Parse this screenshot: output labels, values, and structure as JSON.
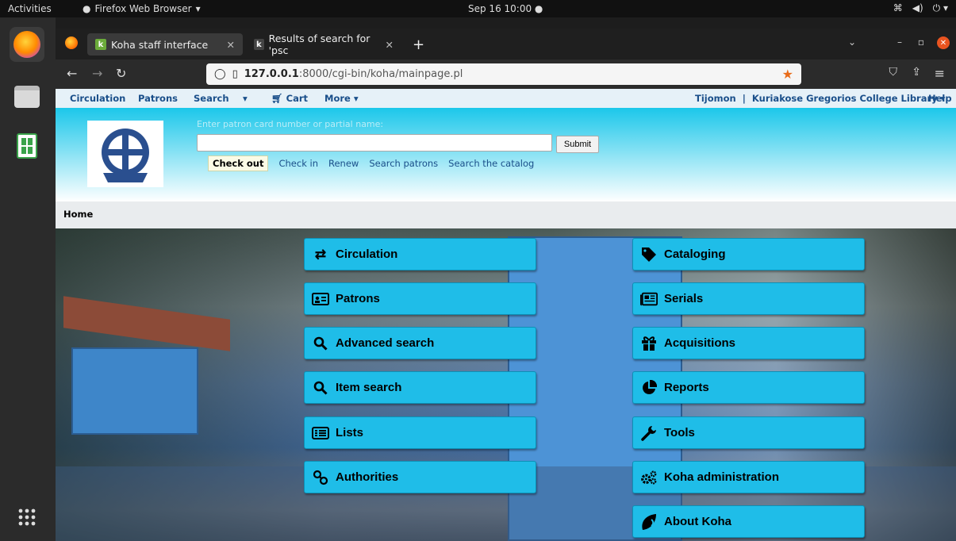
{
  "topbar": {
    "activities": "Activities",
    "app_name": "Firefox Web Browser",
    "clock": "Sep 16 10:00"
  },
  "browser": {
    "tabs": [
      {
        "label": "Koha staff interface"
      },
      {
        "label": "Results of search for 'psc"
      }
    ],
    "url_host": "127.0.0.1",
    "url_path": ":8000/cgi-bin/koha/mainpage.pl"
  },
  "koha_nav": {
    "circulation": "Circulation",
    "patrons": "Patrons",
    "search": "Search",
    "cart": "Cart",
    "more": "More",
    "user": "Tijomon",
    "library": "Kuriakose Gregorios College Library",
    "help": "Help"
  },
  "checkout": {
    "hint": "Enter patron card number or partial name:",
    "submit": "Submit",
    "links": [
      "Check out",
      "Check in",
      "Renew",
      "Search patrons",
      "Search the catalog"
    ]
  },
  "breadcrumb": "Home",
  "modules_left": [
    {
      "label": "Circulation",
      "icon": "exchange-icon"
    },
    {
      "label": "Patrons",
      "icon": "id-card-icon"
    },
    {
      "label": "Advanced search",
      "icon": "search-icon"
    },
    {
      "label": "Item search",
      "icon": "search-icon"
    },
    {
      "label": "Lists",
      "icon": "list-icon"
    },
    {
      "label": "Authorities",
      "icon": "link-icon"
    }
  ],
  "modules_right": [
    {
      "label": "Cataloging",
      "icon": "tag-icon"
    },
    {
      "label": "Serials",
      "icon": "newspaper-icon"
    },
    {
      "label": "Acquisitions",
      "icon": "gift-icon"
    },
    {
      "label": "Reports",
      "icon": "pie-chart-icon"
    },
    {
      "label": "Tools",
      "icon": "wrench-icon"
    },
    {
      "label": "Koha administration",
      "icon": "cogs-icon"
    },
    {
      "label": "About Koha",
      "icon": "koha-leaf-icon"
    }
  ]
}
